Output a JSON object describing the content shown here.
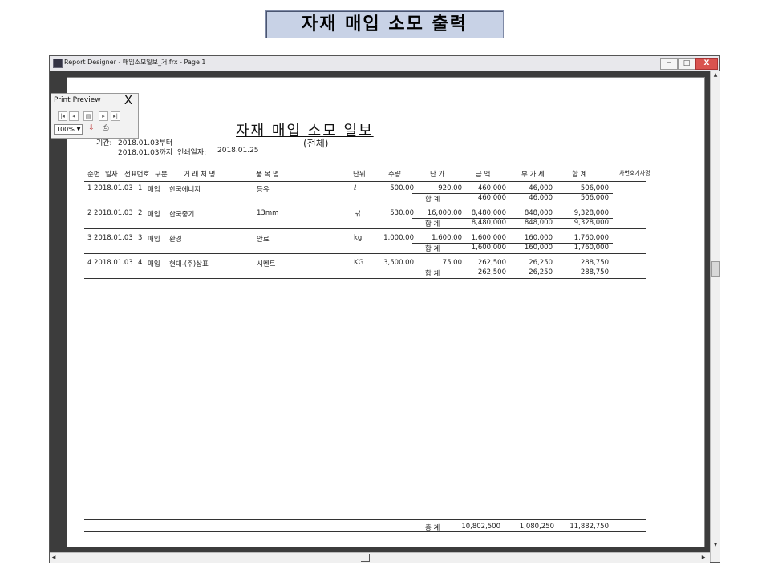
{
  "banner": {
    "title": "자재 매입 소모 출력"
  },
  "window": {
    "title": "Report Designer - 매입소모일보_거.frx - Page 1",
    "min": "─",
    "max": "□",
    "close": "X"
  },
  "print_preview": {
    "title": "Print Preview",
    "close": "X",
    "zoom": "100%",
    "nav": {
      "first": "|◂",
      "prev": "◂",
      "next": "▸",
      "last": "▸|"
    },
    "icons": [
      "first-page-icon",
      "prev-page-icon",
      "page-setup-icon",
      "next-page-icon",
      "last-page-icon",
      "export-icon",
      "print-icon"
    ]
  },
  "report": {
    "title": "자재 매입 소모 일보",
    "subtitle": "(전체)",
    "period_label": "기간:",
    "from": "2018.01.03부터",
    "to": "2018.01.03까지",
    "print_date_label": "인쇄일자:",
    "print_date": "2018.01.25",
    "headers": {
      "seq": "순번",
      "date": "일자",
      "slip": "전표번호",
      "type": "구분",
      "vendor": "거 래 처 명",
      "item": "품 목 명",
      "unit": "단위",
      "qty": "수량",
      "price": "단 가",
      "amount": "금 액",
      "vat": "부 가 세",
      "total": "합 계",
      "vehicle": "차번호기사명"
    },
    "rows": [
      {
        "seq": "1",
        "date": "2018.01.03",
        "slip": "1",
        "type": "매입",
        "vendor": "한국에너지",
        "item": "등유",
        "unit": "ℓ",
        "qty": "500.00",
        "price": "920.00",
        "amount": "460,000",
        "vat": "46,000",
        "total": "506,000",
        "sub_label": "합 계",
        "sub_amount": "460,000",
        "sub_vat": "46,000",
        "sub_total": "506,000"
      },
      {
        "seq": "2",
        "date": "2018.01.03",
        "slip": "2",
        "type": "매입",
        "vendor": "한국중기",
        "item": "13mm",
        "unit": "㎥",
        "qty": "530.00",
        "price": "16,000.00",
        "amount": "8,480,000",
        "vat": "848,000",
        "total": "9,328,000",
        "sub_label": "합 계",
        "sub_amount": "8,480,000",
        "sub_vat": "848,000",
        "sub_total": "9,328,000"
      },
      {
        "seq": "3",
        "date": "2018.01.03",
        "slip": "3",
        "type": "매입",
        "vendor": "환경",
        "item": "안료",
        "unit": "kg",
        "qty": "1,000.00",
        "price": "1,600.00",
        "amount": "1,600,000",
        "vat": "160,000",
        "total": "1,760,000",
        "sub_label": "합 계",
        "sub_amount": "1,600,000",
        "sub_vat": "160,000",
        "sub_total": "1,760,000"
      },
      {
        "seq": "4",
        "date": "2018.01.03",
        "slip": "4",
        "type": "매입",
        "vendor": "현대-(주)삼표",
        "item": "시멘트",
        "unit": "KG",
        "qty": "3,500.00",
        "price": "75.00",
        "amount": "262,500",
        "vat": "26,250",
        "total": "288,750",
        "sub_label": "합 계",
        "sub_amount": "262,500",
        "sub_vat": "26,250",
        "sub_total": "288,750"
      }
    ],
    "grand": {
      "label": "총 계",
      "amount": "10,802,500",
      "vat": "1,080,250",
      "total": "11,882,750"
    }
  }
}
